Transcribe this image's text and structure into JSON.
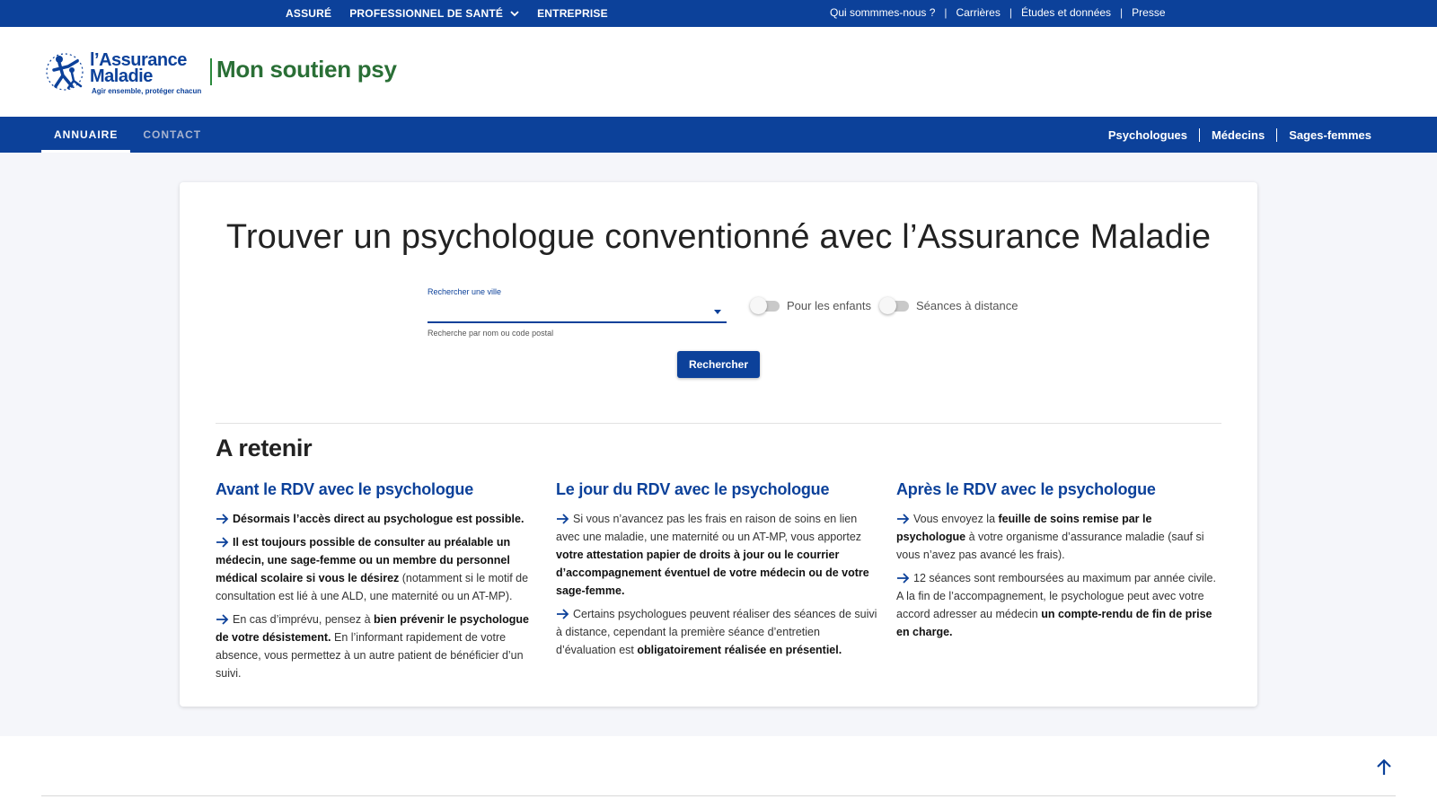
{
  "topbar": {
    "left": [
      {
        "label": "ASSURÉ",
        "has_chevron": false
      },
      {
        "label": "PROFESSIONNEL DE SANTÉ",
        "has_chevron": true
      },
      {
        "label": "ENTREPRISE",
        "has_chevron": false
      }
    ],
    "right": [
      "Qui sommmes-nous ?",
      "Carrières",
      "Études et données",
      "Presse"
    ]
  },
  "header": {
    "logo": {
      "line1": "l’Assurance",
      "line2": "Maladie",
      "tagline": "Agir ensemble, protéger chacun",
      "icon": "assurance-maladie-emblem"
    },
    "site_title": "Mon soutien psy"
  },
  "nav": {
    "tabs": [
      {
        "label": "ANNUAIRE",
        "active": true
      },
      {
        "label": "CONTACT",
        "active": false
      }
    ],
    "links": [
      "Psychologues",
      "Médecins",
      "Sages-femmes"
    ]
  },
  "search": {
    "title": "Trouver un psychologue conventionné avec l’Assurance Maladie",
    "city_label": "Rechercher une ville",
    "city_value": "",
    "city_help": "Recherche par nom ou code postal",
    "toggle_children": {
      "label": "Pour les enfants",
      "on": false
    },
    "toggle_remote": {
      "label": "Séances à distance",
      "on": false
    },
    "button": "Rechercher"
  },
  "retenir": {
    "title": "A retenir",
    "columns": [
      {
        "title": "Avant le RDV avec le psychologue",
        "paragraphs": [
          [
            {
              "b": true,
              "t": "Désormais l’accès direct au psychologue est possible."
            }
          ],
          [
            {
              "b": true,
              "t": "Il est toujours possible de consulter au préalable un médecin, une sage-femme ou un membre du personnel médical scolaire si vous le désirez"
            },
            {
              "b": false,
              "t": " (notamment si le motif de consultation est lié à une ALD, une maternité ou un AT-MP)."
            }
          ],
          [
            {
              "b": false,
              "t": "En cas d’imprévu, pensez à "
            },
            {
              "b": true,
              "t": "bien prévenir le psychologue de votre désistement."
            },
            {
              "b": false,
              "t": " En l’informant rapidement de votre absence, vous permettez à un autre patient de bénéficier d’un suivi."
            }
          ]
        ]
      },
      {
        "title": "Le jour du RDV avec le psychologue",
        "paragraphs": [
          [
            {
              "b": false,
              "t": "Si vous n’avancez pas les frais en raison de soins en lien avec une maladie, une maternité ou un AT-MP, vous apportez "
            },
            {
              "b": true,
              "t": "votre attestation papier de droits à jour ou le courrier d’accompagnement éventuel de votre médecin ou de votre sage-femme."
            }
          ],
          [
            {
              "b": false,
              "t": "Certains psychologues peuvent réaliser des séances de suivi à distance, cependant la première séance d’entretien d’évaluation est "
            },
            {
              "b": true,
              "t": "obligatoirement réalisée en présentiel."
            }
          ]
        ]
      },
      {
        "title": "Après le RDV avec le psychologue",
        "paragraphs": [
          [
            {
              "b": false,
              "t": "Vous envoyez la "
            },
            {
              "b": true,
              "t": "feuille de soins remise par le psychologue"
            },
            {
              "b": false,
              "t": " à votre organisme d’assurance maladie (sauf si vous n’avez pas avancé les frais)."
            }
          ],
          [
            {
              "b": false,
              "t": "12 séances sont remboursées au maximum par année civile. A la fin de l’accompagnement, le psychologue peut avec votre accord adresser au médecin "
            },
            {
              "b": true,
              "t": "un compte-rendu de fin de prise en charge."
            }
          ]
        ]
      }
    ]
  },
  "footer": {
    "back_to_top_icon": "arrow-up-icon"
  },
  "colors": {
    "primary": "#0c419a",
    "brand_green": "#2a6f36",
    "background": "#f5f6fa"
  }
}
